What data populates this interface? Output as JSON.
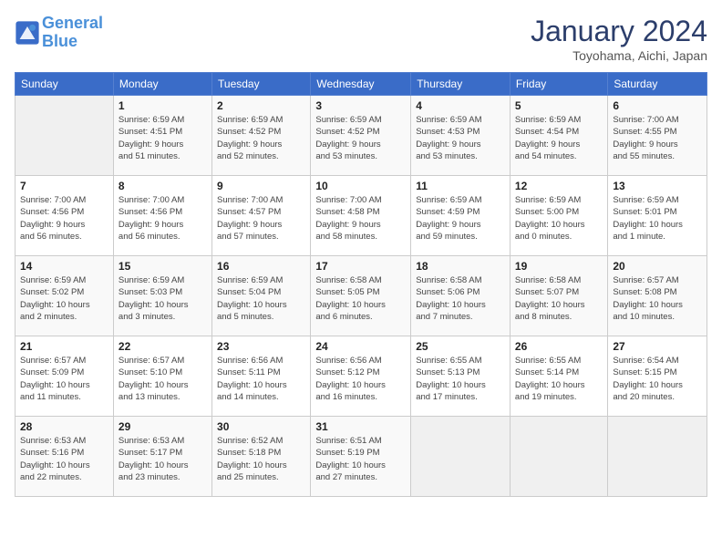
{
  "logo": {
    "line1": "General",
    "line2": "Blue"
  },
  "header": {
    "month": "January 2024",
    "location": "Toyohama, Aichi, Japan"
  },
  "weekdays": [
    "Sunday",
    "Monday",
    "Tuesday",
    "Wednesday",
    "Thursday",
    "Friday",
    "Saturday"
  ],
  "weeks": [
    [
      {
        "date": "",
        "info": ""
      },
      {
        "date": "1",
        "info": "Sunrise: 6:59 AM\nSunset: 4:51 PM\nDaylight: 9 hours\nand 51 minutes."
      },
      {
        "date": "2",
        "info": "Sunrise: 6:59 AM\nSunset: 4:52 PM\nDaylight: 9 hours\nand 52 minutes."
      },
      {
        "date": "3",
        "info": "Sunrise: 6:59 AM\nSunset: 4:52 PM\nDaylight: 9 hours\nand 53 minutes."
      },
      {
        "date": "4",
        "info": "Sunrise: 6:59 AM\nSunset: 4:53 PM\nDaylight: 9 hours\nand 53 minutes."
      },
      {
        "date": "5",
        "info": "Sunrise: 6:59 AM\nSunset: 4:54 PM\nDaylight: 9 hours\nand 54 minutes."
      },
      {
        "date": "6",
        "info": "Sunrise: 7:00 AM\nSunset: 4:55 PM\nDaylight: 9 hours\nand 55 minutes."
      }
    ],
    [
      {
        "date": "7",
        "info": "Sunrise: 7:00 AM\nSunset: 4:56 PM\nDaylight: 9 hours\nand 56 minutes."
      },
      {
        "date": "8",
        "info": "Sunrise: 7:00 AM\nSunset: 4:56 PM\nDaylight: 9 hours\nand 56 minutes."
      },
      {
        "date": "9",
        "info": "Sunrise: 7:00 AM\nSunset: 4:57 PM\nDaylight: 9 hours\nand 57 minutes."
      },
      {
        "date": "10",
        "info": "Sunrise: 7:00 AM\nSunset: 4:58 PM\nDaylight: 9 hours\nand 58 minutes."
      },
      {
        "date": "11",
        "info": "Sunrise: 6:59 AM\nSunset: 4:59 PM\nDaylight: 9 hours\nand 59 minutes."
      },
      {
        "date": "12",
        "info": "Sunrise: 6:59 AM\nSunset: 5:00 PM\nDaylight: 10 hours\nand 0 minutes."
      },
      {
        "date": "13",
        "info": "Sunrise: 6:59 AM\nSunset: 5:01 PM\nDaylight: 10 hours\nand 1 minute."
      }
    ],
    [
      {
        "date": "14",
        "info": "Sunrise: 6:59 AM\nSunset: 5:02 PM\nDaylight: 10 hours\nand 2 minutes."
      },
      {
        "date": "15",
        "info": "Sunrise: 6:59 AM\nSunset: 5:03 PM\nDaylight: 10 hours\nand 3 minutes."
      },
      {
        "date": "16",
        "info": "Sunrise: 6:59 AM\nSunset: 5:04 PM\nDaylight: 10 hours\nand 5 minutes."
      },
      {
        "date": "17",
        "info": "Sunrise: 6:58 AM\nSunset: 5:05 PM\nDaylight: 10 hours\nand 6 minutes."
      },
      {
        "date": "18",
        "info": "Sunrise: 6:58 AM\nSunset: 5:06 PM\nDaylight: 10 hours\nand 7 minutes."
      },
      {
        "date": "19",
        "info": "Sunrise: 6:58 AM\nSunset: 5:07 PM\nDaylight: 10 hours\nand 8 minutes."
      },
      {
        "date": "20",
        "info": "Sunrise: 6:57 AM\nSunset: 5:08 PM\nDaylight: 10 hours\nand 10 minutes."
      }
    ],
    [
      {
        "date": "21",
        "info": "Sunrise: 6:57 AM\nSunset: 5:09 PM\nDaylight: 10 hours\nand 11 minutes."
      },
      {
        "date": "22",
        "info": "Sunrise: 6:57 AM\nSunset: 5:10 PM\nDaylight: 10 hours\nand 13 minutes."
      },
      {
        "date": "23",
        "info": "Sunrise: 6:56 AM\nSunset: 5:11 PM\nDaylight: 10 hours\nand 14 minutes."
      },
      {
        "date": "24",
        "info": "Sunrise: 6:56 AM\nSunset: 5:12 PM\nDaylight: 10 hours\nand 16 minutes."
      },
      {
        "date": "25",
        "info": "Sunrise: 6:55 AM\nSunset: 5:13 PM\nDaylight: 10 hours\nand 17 minutes."
      },
      {
        "date": "26",
        "info": "Sunrise: 6:55 AM\nSunset: 5:14 PM\nDaylight: 10 hours\nand 19 minutes."
      },
      {
        "date": "27",
        "info": "Sunrise: 6:54 AM\nSunset: 5:15 PM\nDaylight: 10 hours\nand 20 minutes."
      }
    ],
    [
      {
        "date": "28",
        "info": "Sunrise: 6:53 AM\nSunset: 5:16 PM\nDaylight: 10 hours\nand 22 minutes."
      },
      {
        "date": "29",
        "info": "Sunrise: 6:53 AM\nSunset: 5:17 PM\nDaylight: 10 hours\nand 23 minutes."
      },
      {
        "date": "30",
        "info": "Sunrise: 6:52 AM\nSunset: 5:18 PM\nDaylight: 10 hours\nand 25 minutes."
      },
      {
        "date": "31",
        "info": "Sunrise: 6:51 AM\nSunset: 5:19 PM\nDaylight: 10 hours\nand 27 minutes."
      },
      {
        "date": "",
        "info": ""
      },
      {
        "date": "",
        "info": ""
      },
      {
        "date": "",
        "info": ""
      }
    ]
  ]
}
